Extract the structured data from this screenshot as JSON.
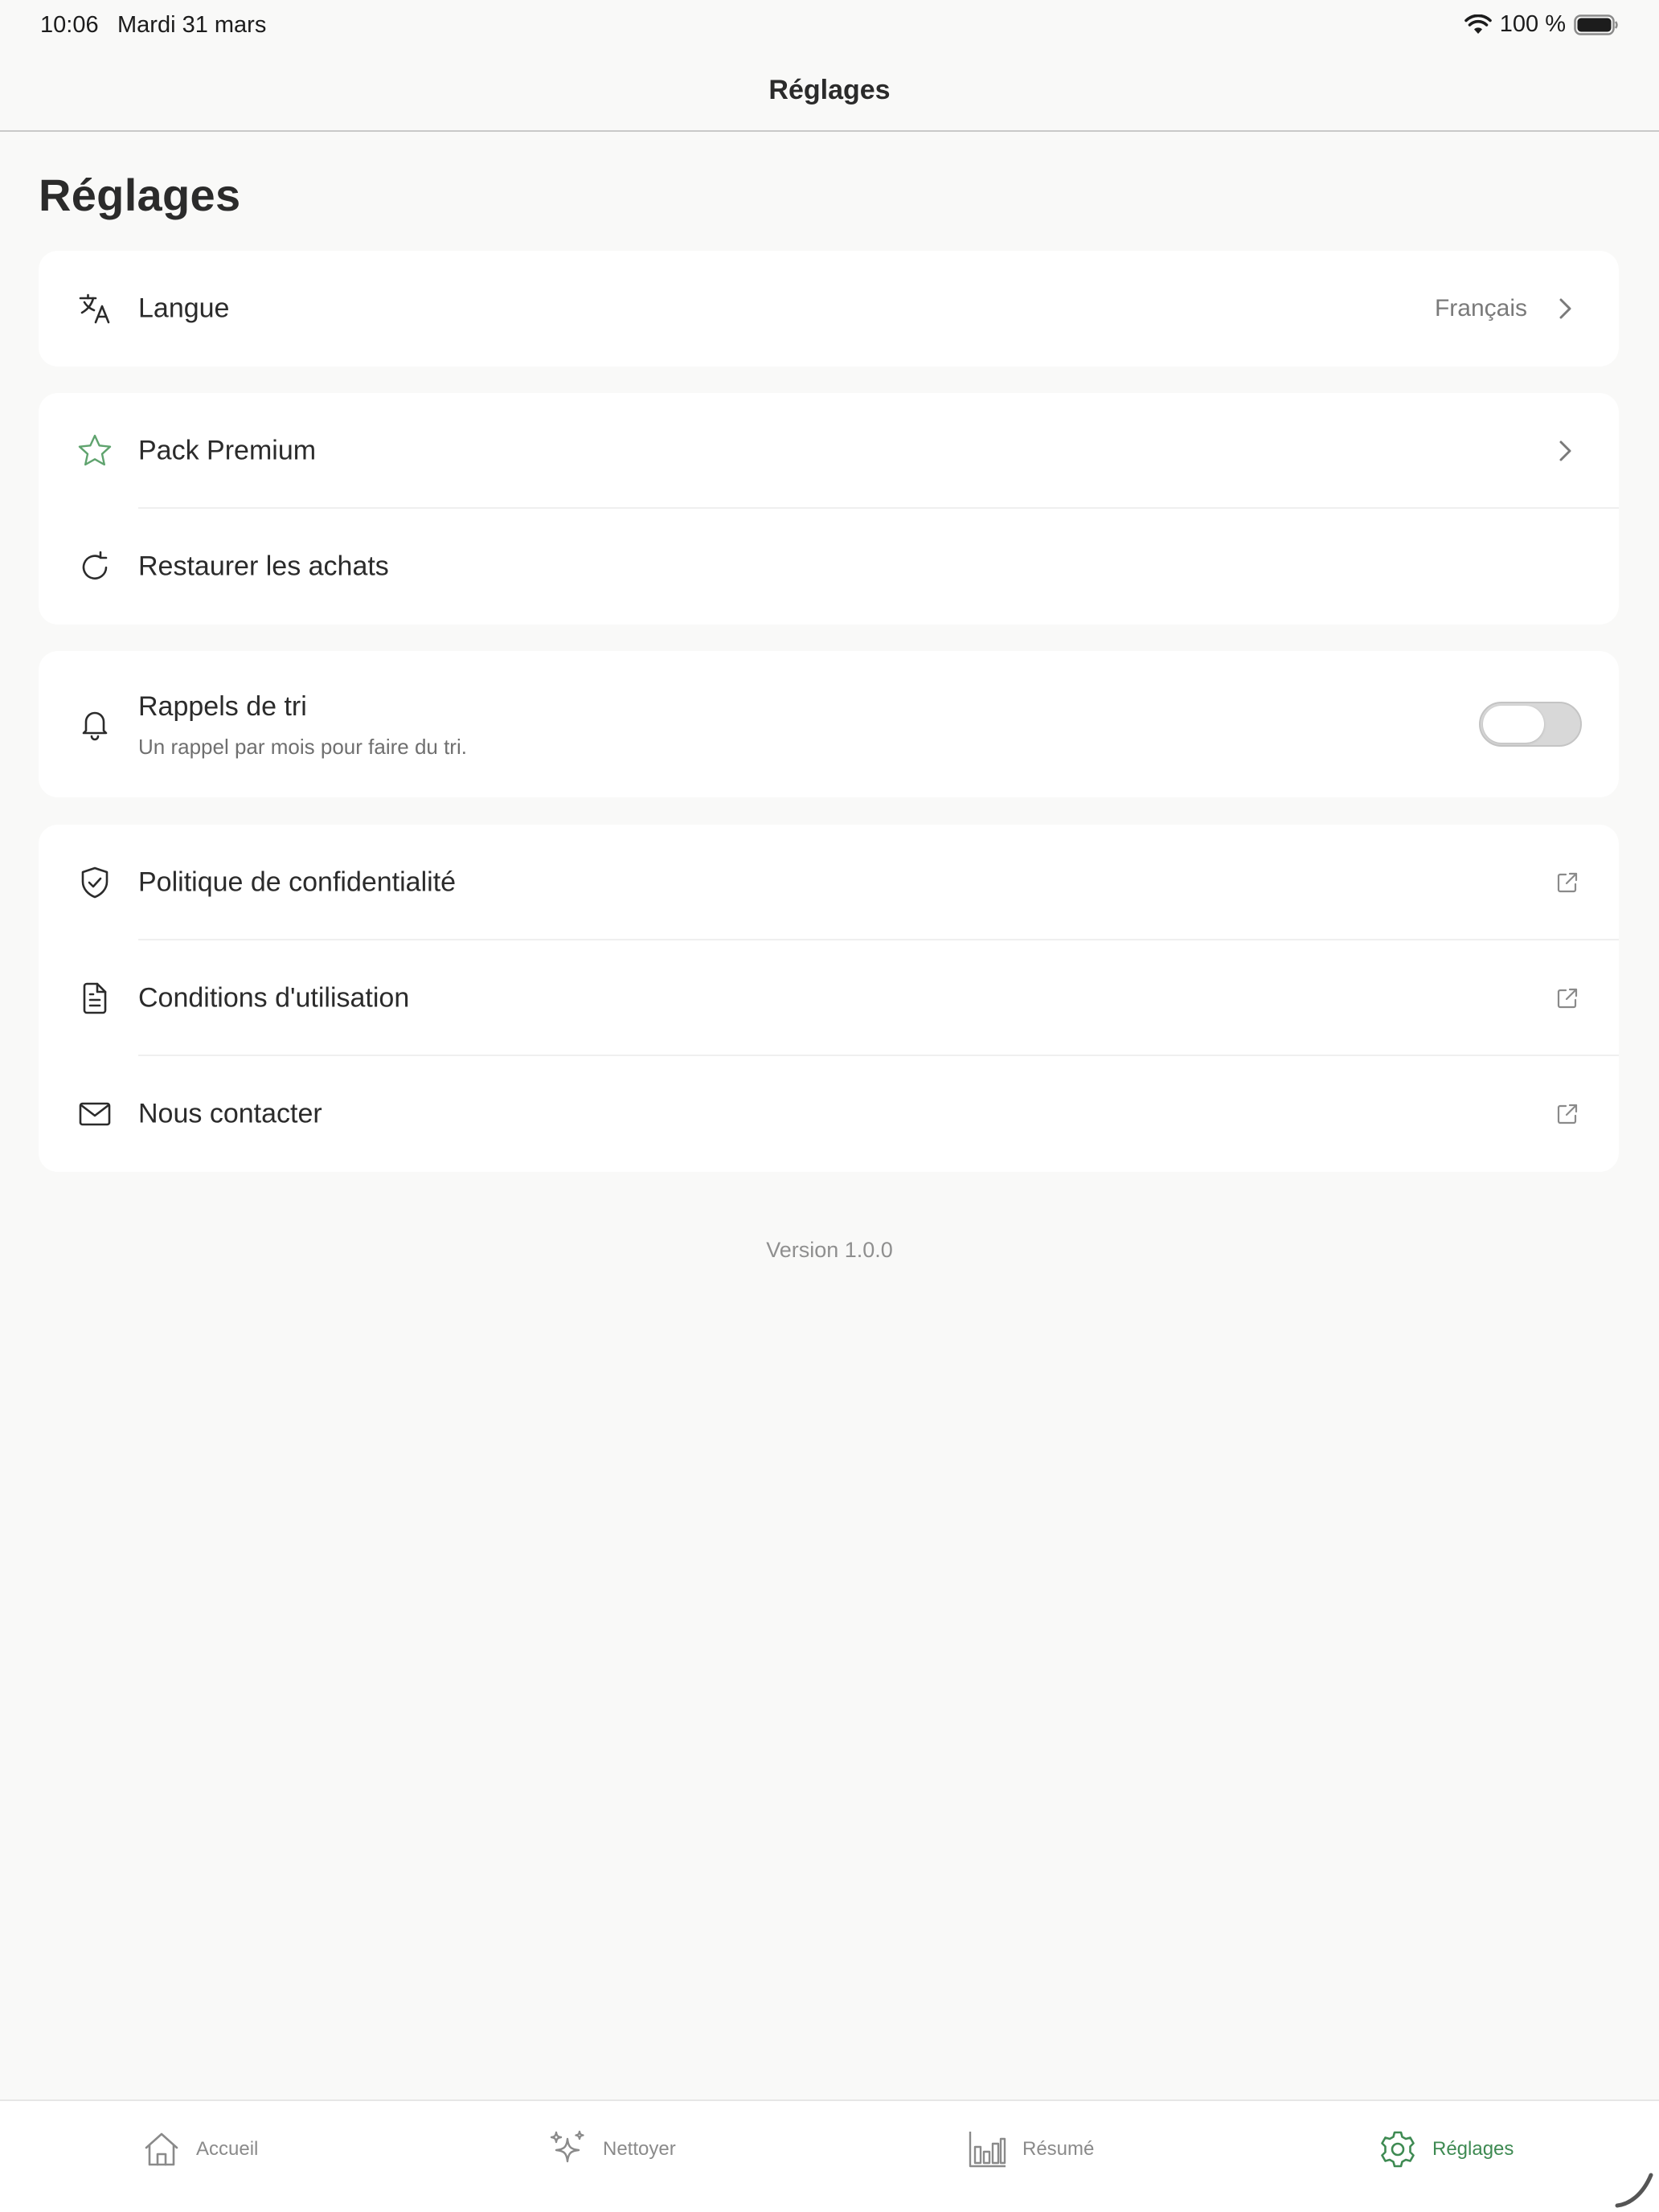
{
  "status_bar": {
    "time": "10:06",
    "date": "Mardi 31 mars",
    "battery": "100 %"
  },
  "nav": {
    "title": "Réglages"
  },
  "page_title": "Réglages",
  "settings": {
    "language": {
      "label": "Langue",
      "value": "Français"
    },
    "premium": {
      "label": "Pack Premium"
    },
    "restore": {
      "label": "Restaurer les achats"
    },
    "reminders": {
      "label": "Rappels de tri",
      "sublabel": "Un rappel par mois pour faire du tri.",
      "enabled": false
    },
    "privacy": {
      "label": "Politique de confidentialité"
    },
    "terms": {
      "label": "Conditions d'utilisation"
    },
    "contact": {
      "label": "Nous contacter"
    }
  },
  "version": "Version 1.0.0",
  "tabs": [
    {
      "label": "Accueil",
      "icon": "house-icon",
      "active": false
    },
    {
      "label": "Nettoyer",
      "icon": "sparkles-icon",
      "active": false
    },
    {
      "label": "Résumé",
      "icon": "bar-chart-icon",
      "active": false
    },
    {
      "label": "Réglages",
      "icon": "gear-icon",
      "active": true
    }
  ],
  "colors": {
    "accent": "#3e8a52",
    "background": "#f9f9f8",
    "card": "#ffffff"
  }
}
